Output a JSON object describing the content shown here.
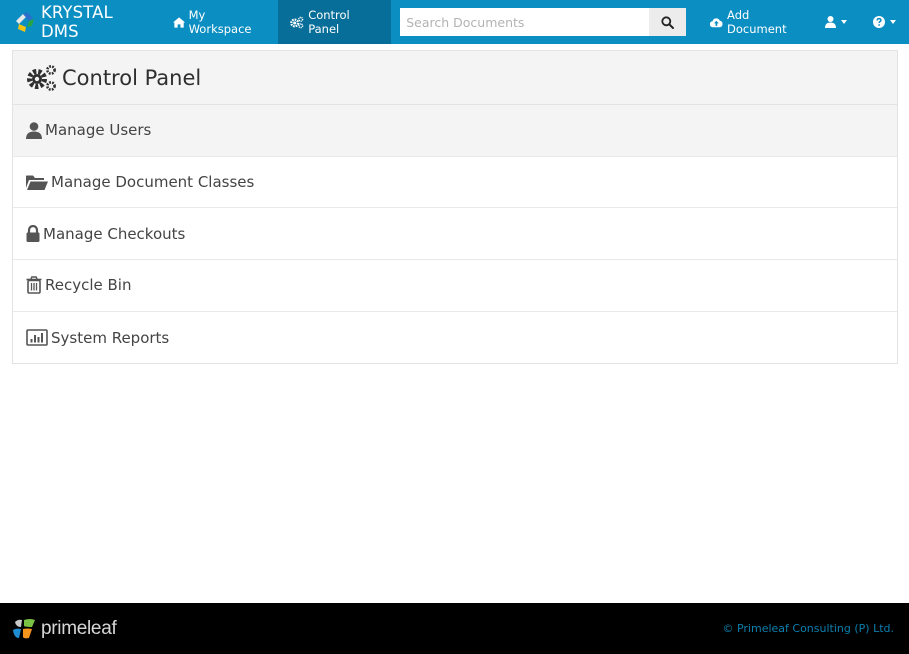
{
  "navbar": {
    "brand": "KRYSTAL DMS",
    "links": [
      {
        "label": "My Workspace",
        "icon": "home-icon",
        "active": false
      },
      {
        "label": "Control Panel",
        "icon": "gears-icon",
        "active": true
      }
    ],
    "search": {
      "placeholder": "Search Documents",
      "value": ""
    },
    "add_document_label": "Add Document",
    "user_menu_icon": "user-icon",
    "help_menu_icon": "question-circle-icon",
    "colors": {
      "bar": "#0b8ec2",
      "active": "#066e98"
    }
  },
  "panel": {
    "title": "Control Panel",
    "items": [
      {
        "label": "Manage Users",
        "icon": "user-icon",
        "active": true
      },
      {
        "label": "Manage Document Classes",
        "icon": "folder-open-icon",
        "active": false
      },
      {
        "label": "Manage Checkouts",
        "icon": "lock-icon",
        "active": false
      },
      {
        "label": "Recycle Bin",
        "icon": "trash-icon",
        "active": false
      },
      {
        "label": "System Reports",
        "icon": "bar-chart-icon",
        "active": false
      }
    ]
  },
  "footer": {
    "brand": "primeleaf",
    "copyright": "© Primeleaf Consulting (P) Ltd."
  }
}
